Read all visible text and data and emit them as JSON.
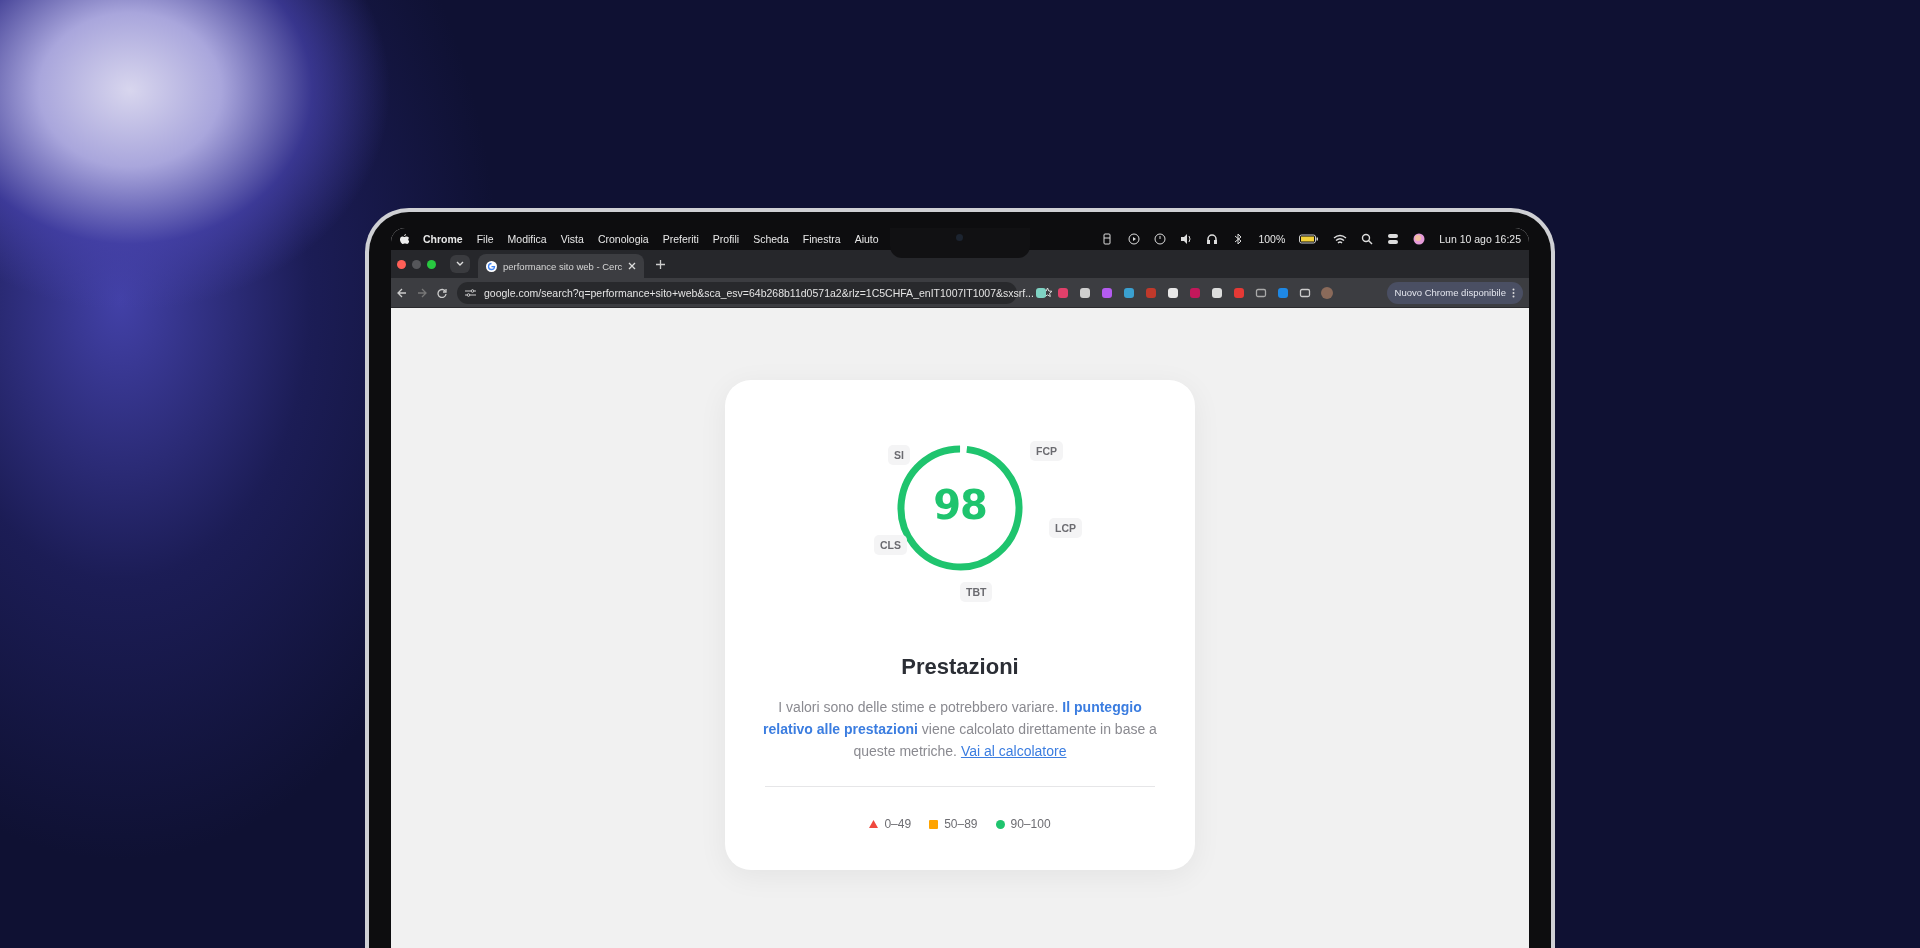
{
  "menu_bar": {
    "app_name": "Chrome",
    "items": [
      "File",
      "Modifica",
      "Vista",
      "Cronologia",
      "Preferiti",
      "Profili",
      "Scheda",
      "Finestra",
      "Aiuto"
    ],
    "battery": "100%",
    "datetime": "Lun 10 ago 16:25"
  },
  "tabs": [
    {
      "title": "performance sito web - Cerc",
      "selected": true
    }
  ],
  "address_bar": {
    "url": "google.com/search?q=performance+sito+web&sca_esv=64b268b11d0571a2&rlz=1C5CHFA_enIT1007IT1007&sxsrf..."
  },
  "update_button": "Nuovo Chrome disponibile",
  "card": {
    "gauge": {
      "score": "98",
      "level": 0.98
    },
    "metrics": [
      "SI",
      "FCP",
      "LCP",
      "CLS",
      "TBT"
    ],
    "title": "Prestazioni",
    "description": [
      {
        "kind": "text",
        "text": "I valori sono delle stime e potrebbero variare. "
      },
      {
        "kind": "bold_link",
        "text": "Il punteggio"
      },
      {
        "kind": "bold_link",
        "text": "relativo alle prestazioni"
      },
      {
        "kind": "text",
        "text": " viene calcolato direttamente in base a queste metriche. "
      },
      {
        "kind": "link",
        "text": "Vai al calcolatore"
      }
    ],
    "legend": [
      {
        "kind": "triangle",
        "label": "0–49",
        "color": "#f0483e"
      },
      {
        "kind": "square",
        "label": "50–89",
        "color": "#ffa400"
      },
      {
        "kind": "circle",
        "label": "90–100",
        "color": "#1fc46e"
      }
    ]
  }
}
